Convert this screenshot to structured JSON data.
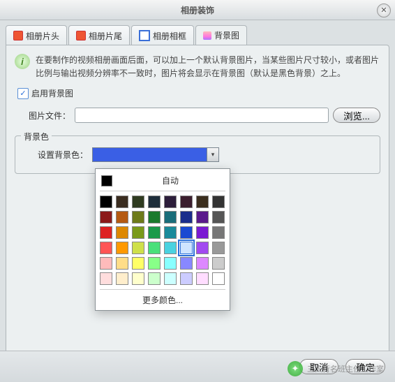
{
  "window": {
    "title": "相册装饰"
  },
  "tabs": [
    {
      "label": "相册片头"
    },
    {
      "label": "相册片尾"
    },
    {
      "label": "相册相框"
    },
    {
      "label": "背景图"
    }
  ],
  "info": "在要制作的视频相册画面后面，可以加上一个默认背景图片，当某些图片尺寸较小，或者图片比例与输出视频分辨率不一致时，图片将会显示在背景图（默认是黑色背景）之上。",
  "enable": {
    "label": "启用背景图",
    "checked": true
  },
  "image": {
    "label": "图片文件：",
    "value": "",
    "browse": "浏览..."
  },
  "bg": {
    "legend": "背景色",
    "label": "设置背景色：",
    "selected": "#3a5fe5",
    "popup": {
      "auto": "自动",
      "auto_color": "#000000",
      "more": "更多颜色...",
      "rows": [
        [
          "#000000",
          "#3b2d20",
          "#2f3b20",
          "#1e2e3b",
          "#2d1e3b",
          "#3b1e2e",
          "#3b2e1e",
          "#333333"
        ],
        [
          "#8b1a1a",
          "#b55a12",
          "#6d7a1a",
          "#1a7a2d",
          "#1a6d7a",
          "#1a2d8b",
          "#5a1a8b",
          "#555555"
        ],
        [
          "#d22",
          "#d80",
          "#7a9a1a",
          "#1a9a4a",
          "#1a8a9a",
          "#1a4ad2",
          "#7a1ad2",
          "#777777"
        ],
        [
          "#f55",
          "#f90",
          "#cfe04a",
          "#4ae07a",
          "#4ad2e0",
          "#4a6af0",
          "#a24af0",
          "#999999"
        ],
        [
          "#fbb",
          "#fd8",
          "#ff6",
          "#8f8",
          "#8ff",
          "#88f",
          "#d8f",
          "#ccc"
        ],
        [
          "#fdd",
          "#fec",
          "#ffc",
          "#cfc",
          "#cff",
          "#ccf",
          "#fdf",
          "#fff"
        ]
      ],
      "selected_index": [
        3,
        5
      ]
    }
  },
  "buttons": {
    "cancel": "取消",
    "ok": "确定"
  },
  "watermark": "三人行名班主任工作室"
}
